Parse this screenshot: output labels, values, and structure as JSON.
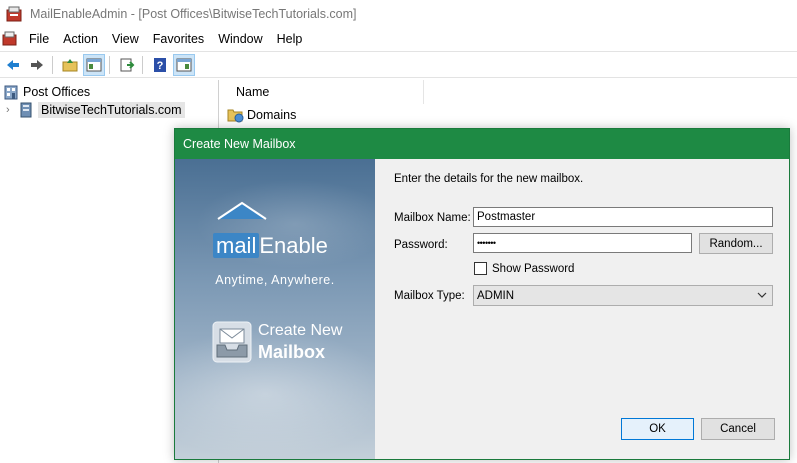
{
  "window": {
    "title": "MailEnableAdmin - [Post Offices\\BitwiseTechTutorials.com]"
  },
  "menu": [
    "File",
    "Action",
    "View",
    "Favorites",
    "Window",
    "Help"
  ],
  "toolbar": {
    "icons": [
      "back-arrow-icon",
      "forward-arrow-icon",
      "up-folder-icon",
      "show-hide-tree-icon",
      "export-list-icon",
      "help-icon",
      "properties-icon"
    ]
  },
  "tree": {
    "root": "Post Offices",
    "child": "BitwiseTechTutorials.com"
  },
  "list": {
    "column_name": "Name",
    "rows": [
      "Domains"
    ]
  },
  "dialog": {
    "title": "Create New Mailbox",
    "brand_mail": "mail",
    "brand_enable": "Enable",
    "tagline": "Anytime, Anywhere.",
    "banner_line1": "Create New",
    "banner_line2": "Mailbox",
    "intro": "Enter the details for the new mailbox.",
    "mailbox_name_label": "Mailbox Name:",
    "mailbox_name_value": "Postmaster",
    "password_label": "Password:",
    "password_value": "•••••••",
    "random_button": "Random...",
    "show_password_label": "Show Password",
    "show_password_checked": false,
    "mailbox_type_label": "Mailbox Type:",
    "mailbox_type_value": "ADMIN",
    "ok_button": "OK",
    "cancel_button": "Cancel"
  },
  "colors": {
    "dialog_title_bar": "#1e8a44",
    "selection": "#e5e5e5",
    "default_button_border": "#0078d7"
  }
}
